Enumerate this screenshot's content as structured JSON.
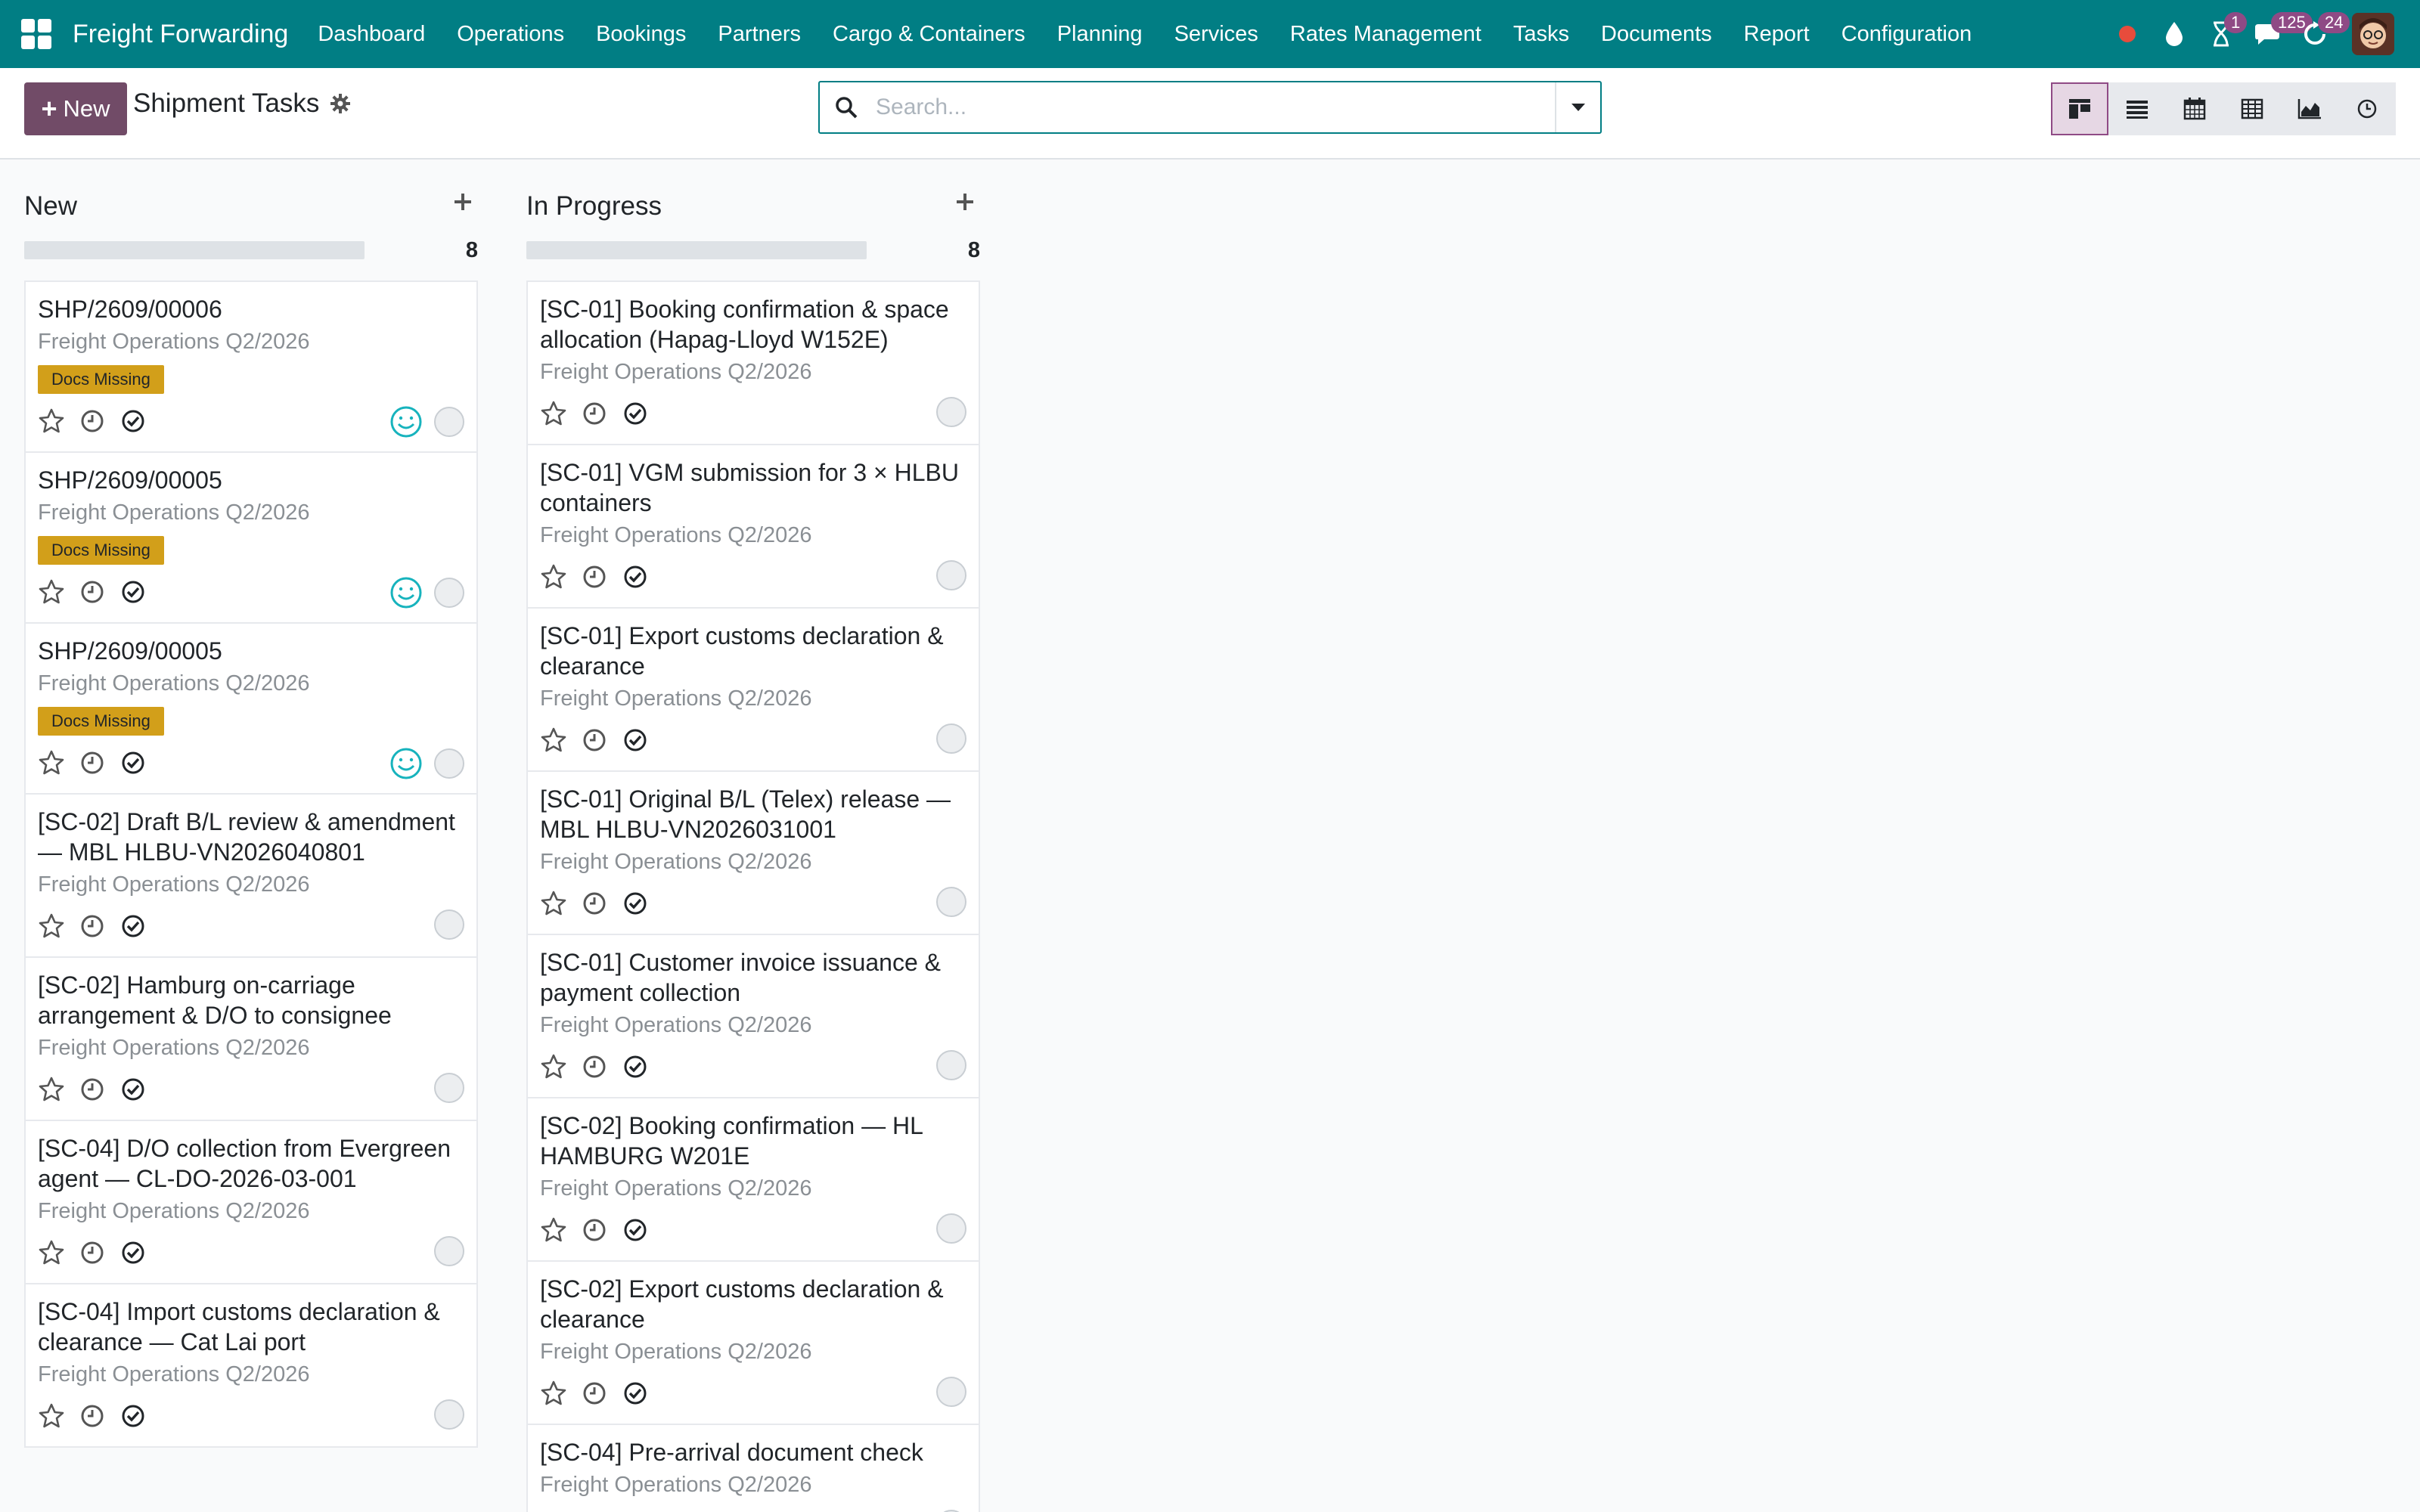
{
  "navbar": {
    "brand": "Freight Forwarding",
    "menu": [
      "Dashboard",
      "Operations",
      "Bookings",
      "Partners",
      "Cargo & Containers",
      "Planning",
      "Services",
      "Rates Management",
      "Tasks",
      "Documents",
      "Report",
      "Configuration"
    ],
    "systray": {
      "activity_badge": "1",
      "messages_badge": "125",
      "updates_badge": "24"
    },
    "colors": {
      "bar": "#017e84",
      "badge": "#8f4a85",
      "record_dot": "#e74c3c"
    }
  },
  "control": {
    "new_label": "New",
    "breadcrumb": "Shipment Tasks",
    "search_placeholder": "Search...",
    "views": [
      "kanban-icon",
      "list-icon",
      "calendar-icon",
      "pivot-icon",
      "graph-icon",
      "activity-icon"
    ],
    "active_view": "kanban"
  },
  "columns": [
    {
      "title": "New",
      "count": "8",
      "cards": [
        {
          "title": "SHP/2609/00006",
          "project": "Freight Operations Q2/2026",
          "tag": "Docs Missing",
          "smiley": true
        },
        {
          "title": "SHP/2609/00005",
          "project": "Freight Operations Q2/2026",
          "tag": "Docs Missing",
          "smiley": true
        },
        {
          "title": "SHP/2609/00005",
          "project": "Freight Operations Q2/2026",
          "tag": "Docs Missing",
          "smiley": true
        },
        {
          "title": "[SC-02] Draft B/L review & amendment — MBL HLBU-VN2026040801",
          "project": "Freight Operations Q2/2026",
          "tag": "",
          "smiley": false
        },
        {
          "title": "[SC-02] Hamburg on-carriage arrangement & D/O to consignee",
          "project": "Freight Operations Q2/2026",
          "tag": "",
          "smiley": false
        },
        {
          "title": "[SC-04] D/O collection from Evergreen agent — CL-DO-2026-03-001",
          "project": "Freight Operations Q2/2026",
          "tag": "",
          "smiley": false
        },
        {
          "title": "[SC-04] Import customs declaration & clearance — Cat Lai port",
          "project": "Freight Operations Q2/2026",
          "tag": "",
          "smiley": false
        }
      ]
    },
    {
      "title": "In Progress",
      "count": "8",
      "cards": [
        {
          "title": "[SC-01] Booking confirmation & space allocation (Hapag-Lloyd W152E)",
          "project": "Freight Operations Q2/2026",
          "tag": "",
          "smiley": false
        },
        {
          "title": "[SC-01] VGM submission for 3 × HLBU containers",
          "project": "Freight Operations Q2/2026",
          "tag": "",
          "smiley": false
        },
        {
          "title": "[SC-01] Export customs declaration & clearance",
          "project": "Freight Operations Q2/2026",
          "tag": "",
          "smiley": false
        },
        {
          "title": "[SC-01] Original B/L (Telex) release — MBL HLBU-VN2026031001",
          "project": "Freight Operations Q2/2026",
          "tag": "",
          "smiley": false
        },
        {
          "title": "[SC-01] Customer invoice issuance & payment collection",
          "project": "Freight Operations Q2/2026",
          "tag": "",
          "smiley": false
        },
        {
          "title": "[SC-02] Booking confirmation — HL HAMBURG W201E",
          "project": "Freight Operations Q2/2026",
          "tag": "",
          "smiley": false
        },
        {
          "title": "[SC-02] Export customs declaration & clearance",
          "project": "Freight Operations Q2/2026",
          "tag": "",
          "smiley": false
        },
        {
          "title": "[SC-04] Pre-arrival document check",
          "project": "Freight Operations Q2/2026",
          "tag": "",
          "smiley": false
        }
      ]
    }
  ]
}
